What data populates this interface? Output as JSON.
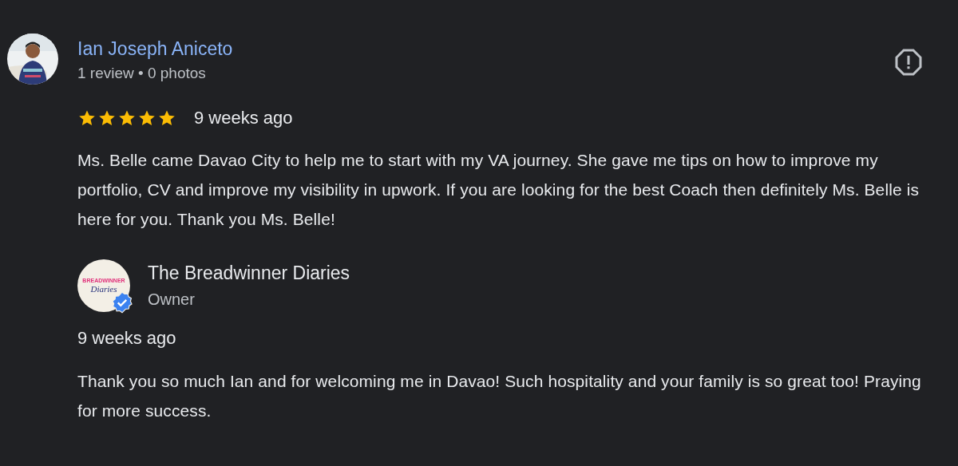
{
  "review": {
    "author": "Ian Joseph Aniceto",
    "meta": "1 review • 0 photos",
    "stars": 5,
    "time": "9 weeks ago",
    "text": "Ms. Belle came Davao City to help me to start with my VA journey. She gave me tips on how to improve my portfolio, CV and improve my visibility in upwork. If you are looking for the best Coach then definitely Ms. Belle is here for you. Thank you Ms. Belle!"
  },
  "owner_response": {
    "name": "The Breadwinner Diaries",
    "role": "Owner",
    "verified": true,
    "logo_text": [
      "BREADWINNER",
      "Diaries"
    ],
    "time": "9 weeks ago",
    "text": "Thank you so much Ian and for welcoming me in Davao! Such hospitality and your family is so great too! Praying for more success."
  }
}
